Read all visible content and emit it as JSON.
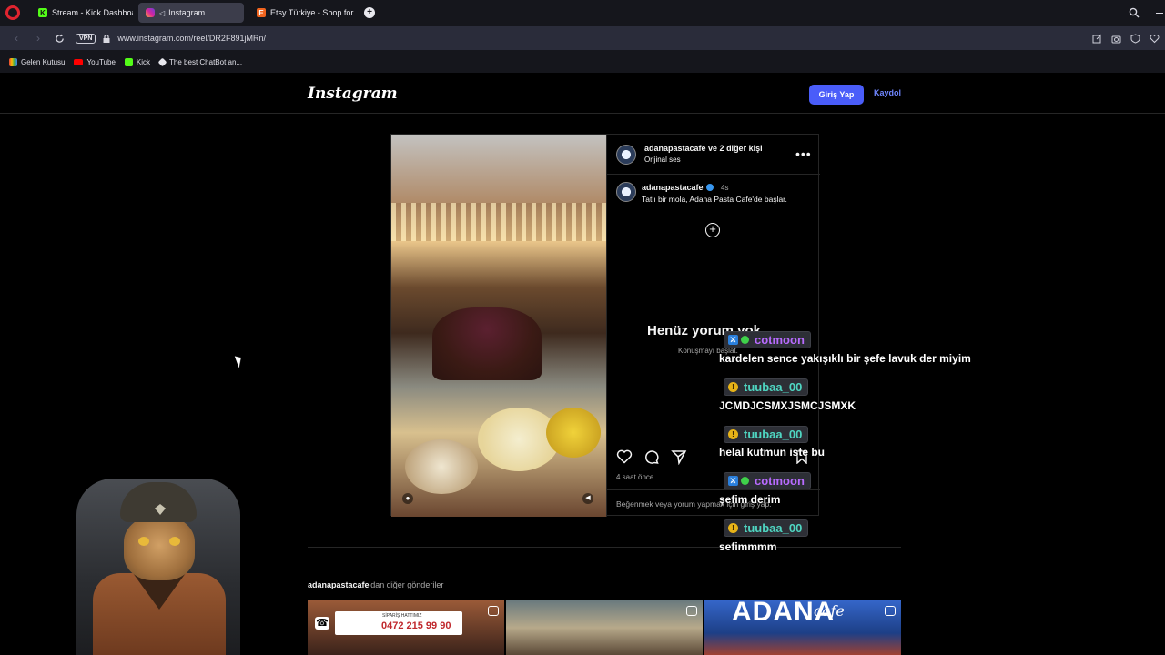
{
  "browser": {
    "tabs": [
      {
        "label": "Stream - Kick Dashboard",
        "active": false,
        "icon": "kick-icon"
      },
      {
        "label": "Instagram",
        "active": true,
        "icon": "instagram-icon"
      },
      {
        "label": "Etsy Türkiye - Shop for ha",
        "active": false,
        "icon": "etsy-icon"
      }
    ],
    "vpn_label": "VPN",
    "url": "www.instagram.com/reel/DR2F891jMRn/",
    "bookmarks": [
      {
        "label": "Gelen Kutusu",
        "icon": "gmail-icon"
      },
      {
        "label": "YouTube",
        "icon": "youtube-icon"
      },
      {
        "label": "Kick",
        "icon": "kick-icon"
      },
      {
        "label": "The best ChatBot an...",
        "icon": "chatbot-icon"
      }
    ]
  },
  "instagram": {
    "logo": "Instagram",
    "login_label": "Giriş Yap",
    "signup_label": "Kaydol",
    "post": {
      "header_user": "adanapastacafe",
      "header_suffix": " ve 2 diğer kişi",
      "audio": "Orijinal ses",
      "caption_user": "adanapastacafe",
      "caption_time": "4s",
      "caption_text": "Tatlı bir mola, Adana Pasta Cafe'de başlar.",
      "no_comments_title": "Henüz yorum yok.",
      "no_comments_sub": "Konuşmayı başlat.",
      "post_time": "4 saat önce",
      "like_prompt": "Beğenmek veya yorum yapmak için giriş yap."
    },
    "more_posts_user": "adanapastacafe",
    "more_posts_suffix": "'dan diğer gönderiler",
    "thumb1_label": "SİPARİŞ HATTIMIZ",
    "thumb1_phone": "0472 215 99 90",
    "thumb3_text": "ADANA",
    "thumb3_sub": "cafe"
  },
  "chat": {
    "colors": {
      "cotmoon": "#b86bff",
      "tuubaa_00": "#4fd6c2"
    },
    "messages": [
      {
        "user": "cotmoon",
        "text": "kardelen sence yakışıklı bir şefe lavuk der miyim"
      },
      {
        "user": "tuubaa_00",
        "text": "JCMDJCSMXJSMCJSMXK"
      },
      {
        "user": "tuubaa_00",
        "text": "helal kutmun iste bu"
      },
      {
        "user": "cotmoon",
        "text": "şefim derim"
      },
      {
        "user": "tuubaa_00",
        "text": "sefimmmm"
      }
    ]
  }
}
